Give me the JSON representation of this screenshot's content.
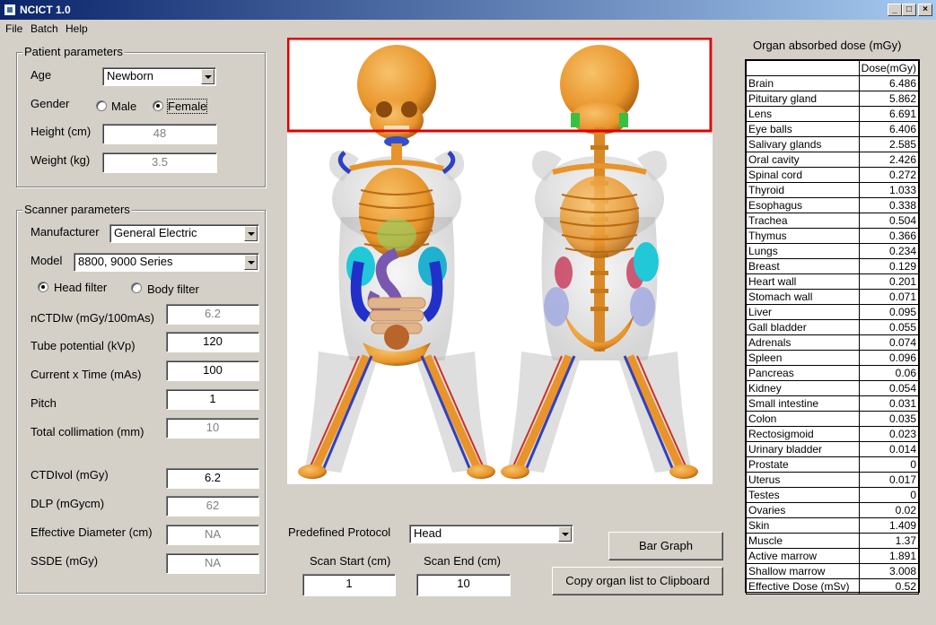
{
  "window": {
    "title": "NCICT 1.0"
  },
  "menu": [
    "File",
    "Batch",
    "Help"
  ],
  "patient": {
    "group_title": "Patient parameters",
    "age_label": "Age",
    "age_value": "Newborn",
    "gender_label": "Gender",
    "male_label": "Male",
    "female_label": "Female",
    "gender_selected": "Female",
    "height_label": "Height (cm)",
    "height_value": "48",
    "weight_label": "Weight (kg)",
    "weight_value": "3.5"
  },
  "scanner": {
    "group_title": "Scanner parameters",
    "manufacturer_label": "Manufacturer",
    "manufacturer_value": "General Electric",
    "model_label": "Model",
    "model_value": "8800, 9000 Series",
    "head_filter_label": "Head filter",
    "body_filter_label": "Body filter",
    "filter_selected": "Head filter",
    "nctdiw_label": "nCTDIw (mGy/100mAs)",
    "nctdiw_value": "6.2",
    "kvp_label": "Tube potential (kVp)",
    "kvp_value": "120",
    "mas_label": "Current x Time (mAs)",
    "mas_value": "100",
    "pitch_label": "Pitch",
    "pitch_value": "1",
    "collimation_label": "Total collimation (mm)",
    "collimation_value": "10",
    "ctdivol_label": "CTDIvol (mGy)",
    "ctdivol_value": "6.2",
    "dlp_label": "DLP (mGycm)",
    "dlp_value": "62",
    "diameter_label": "Effective Diameter (cm)",
    "diameter_value": "NA",
    "ssde_label": "SSDE (mGy)",
    "ssde_value": "NA"
  },
  "protocol": {
    "label": "Predefined Protocol",
    "value": "Head",
    "scan_start_label": "Scan Start (cm)",
    "scan_start_value": "1",
    "scan_end_label": "Scan End (cm)",
    "scan_end_value": "10"
  },
  "buttons": {
    "bar_graph": "Bar Graph",
    "copy_clipboard": "Copy organ list to Clipboard"
  },
  "dose": {
    "heading": "Organ absorbed dose (mGy)",
    "column_header": "Dose(mGy)",
    "rows": [
      [
        "Brain",
        "6.486"
      ],
      [
        "Pituitary gland",
        "5.862"
      ],
      [
        "Lens",
        "6.691"
      ],
      [
        "Eye balls",
        "6.406"
      ],
      [
        "Salivary glands",
        "2.585"
      ],
      [
        "Oral cavity",
        "2.426"
      ],
      [
        "Spinal cord",
        "0.272"
      ],
      [
        "Thyroid",
        "1.033"
      ],
      [
        "Esophagus",
        "0.338"
      ],
      [
        "Trachea",
        "0.504"
      ],
      [
        "Thymus",
        "0.366"
      ],
      [
        "Lungs",
        "0.234"
      ],
      [
        "Breast",
        "0.129"
      ],
      [
        "Heart wall",
        "0.201"
      ],
      [
        "Stomach wall",
        "0.071"
      ],
      [
        "Liver",
        "0.095"
      ],
      [
        "Gall bladder",
        "0.055"
      ],
      [
        "Adrenals",
        "0.074"
      ],
      [
        "Spleen",
        "0.096"
      ],
      [
        "Pancreas",
        "0.06"
      ],
      [
        "Kidney",
        "0.054"
      ],
      [
        "Small intestine",
        "0.031"
      ],
      [
        "Colon",
        "0.035"
      ],
      [
        "Rectosigmoid",
        "0.023"
      ],
      [
        "Urinary bladder",
        "0.014"
      ],
      [
        "Prostate",
        "0"
      ],
      [
        "Uterus",
        "0.017"
      ],
      [
        "Testes",
        "0"
      ],
      [
        "Ovaries",
        "0.02"
      ],
      [
        "Skin",
        "1.409"
      ],
      [
        "Muscle",
        "1.37"
      ],
      [
        "Active marrow",
        "1.891"
      ],
      [
        "Shallow marrow",
        "3.008"
      ],
      [
        "Effective Dose (mSv)",
        "0.52"
      ]
    ]
  },
  "colors": {
    "scan_region": "#e00000",
    "bone": "#e8942a",
    "titlebar": "#0a246a"
  }
}
